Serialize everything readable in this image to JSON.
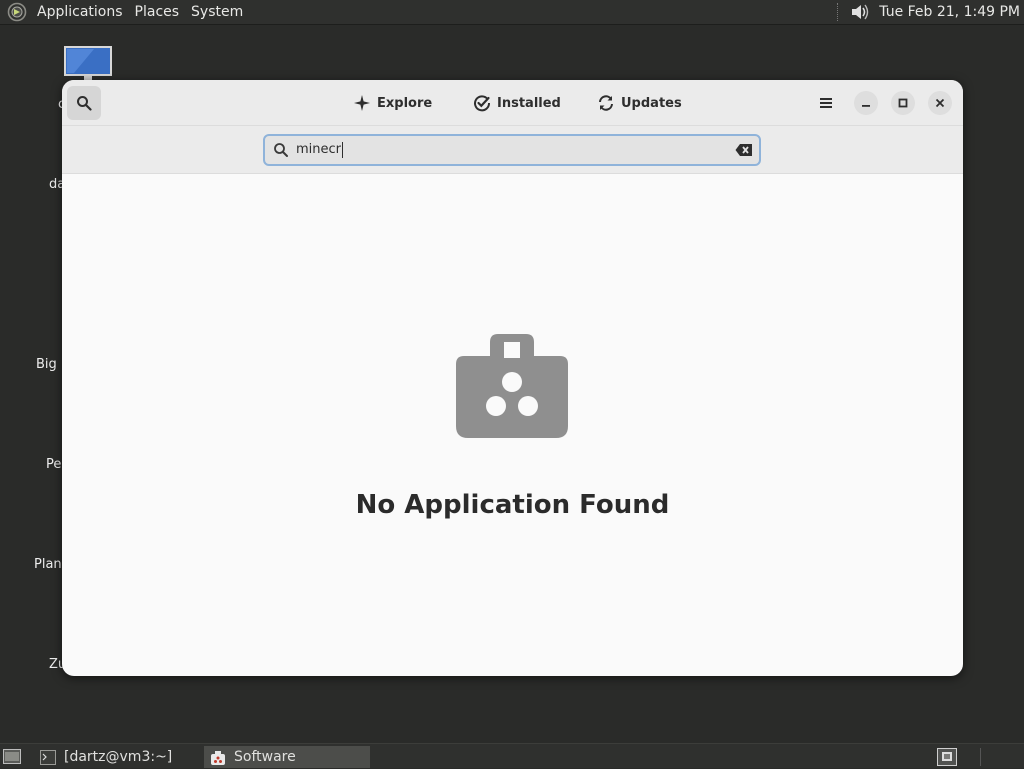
{
  "top_panel": {
    "menus": [
      "Applications",
      "Places",
      "System"
    ],
    "clock": "Tue Feb 21,  1:49 PM"
  },
  "desktop": {
    "labels": [
      "c",
      "da",
      "Big N",
      "Pe",
      "Plan",
      "Zu"
    ]
  },
  "window": {
    "tabs": {
      "explore": "Explore",
      "installed": "Installed",
      "updates": "Updates"
    },
    "search": {
      "value": "minecr"
    },
    "empty_state": {
      "title": "No Application Found"
    }
  },
  "taskbar": {
    "tasks": [
      "[dartz@vm3:~]",
      "Software"
    ]
  },
  "colors": {
    "accent_focus": "#8fb3da",
    "panel": "#2f302e",
    "window_bg": "#fafafa"
  }
}
